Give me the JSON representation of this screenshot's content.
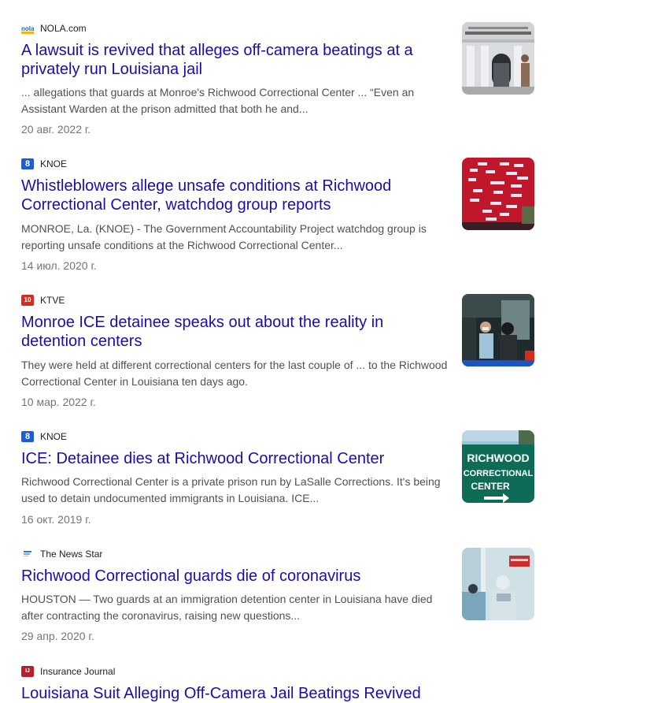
{
  "results": [
    {
      "source": "NOLA.com",
      "favicon": "nola-icon",
      "favicon_text": "nola",
      "title": "A lawsuit is revived that alleges off-camera beatings at a privately run Louisiana jail",
      "snippet": "... allegations that guards at Monroe's Richwood Correctional Center ... “Even an Assistant Warden at the prison admitted that both he and...",
      "date": "20 авг. 2022 г.",
      "thumb": "courthouse-photo"
    },
    {
      "source": "KNOE",
      "favicon": "knoe-icon",
      "favicon_text": "8",
      "title": "Whistleblowers allege unsafe conditions at Richwood Correctional Center, watchdog group reports",
      "snippet": "MONROE, La. (KNOE) - The Government Accountability Project watchdog group is reporting unsafe conditions at the Richwood Correctional Center...",
      "date": "14 июл. 2020 г.",
      "thumb": "map-photo"
    },
    {
      "source": "KTVE",
      "favicon": "ktve-icon",
      "favicon_text": "10",
      "title": "Monroe ICE detainee speaks out about the reality in detention centers",
      "snippet": "They were held at different correctional centers for the last couple of ... to the Richwood Correctional Center in Louisiana ten days ago.",
      "date": "10 мар. 2022 г.",
      "thumb": "detainee-photo"
    },
    {
      "source": "KNOE",
      "favicon": "knoe-icon",
      "favicon_text": "8",
      "title": "ICE: Detainee dies at Richwood Correctional Center",
      "snippet": "Richwood Correctional Center is a private prison run by LaSalle Corrections. It's being used to detain undocumented immigrants in Louisiana. ICE...",
      "date": "16 окт. 2019 г.",
      "thumb": "sign-photo",
      "thumb_text": [
        "RICHWOOD",
        "CORRECTIONAL",
        "CENTER"
      ]
    },
    {
      "source": "The News Star",
      "favicon": "newsstar-icon",
      "favicon_text": "",
      "title": "Richwood Correctional guards die of coronavirus",
      "snippet": "HOUSTON — Two guards at an immigration detention center in Louisiana have died after contracting the coronavirus, raising new questions...",
      "date": "29 апр. 2020 г.",
      "thumb": "hospital-photo"
    },
    {
      "source": "Insurance Journal",
      "favicon": "ij-icon",
      "favicon_text": "IJ",
      "title": "Louisiana Suit Alleging Off-Camera Jail Beatings Revived",
      "snippet": "",
      "date": "",
      "thumb": ""
    }
  ],
  "colors": {
    "title": "#1a0dab",
    "snippet": "#4d5156",
    "date": "#70757a",
    "source": "#202124"
  }
}
